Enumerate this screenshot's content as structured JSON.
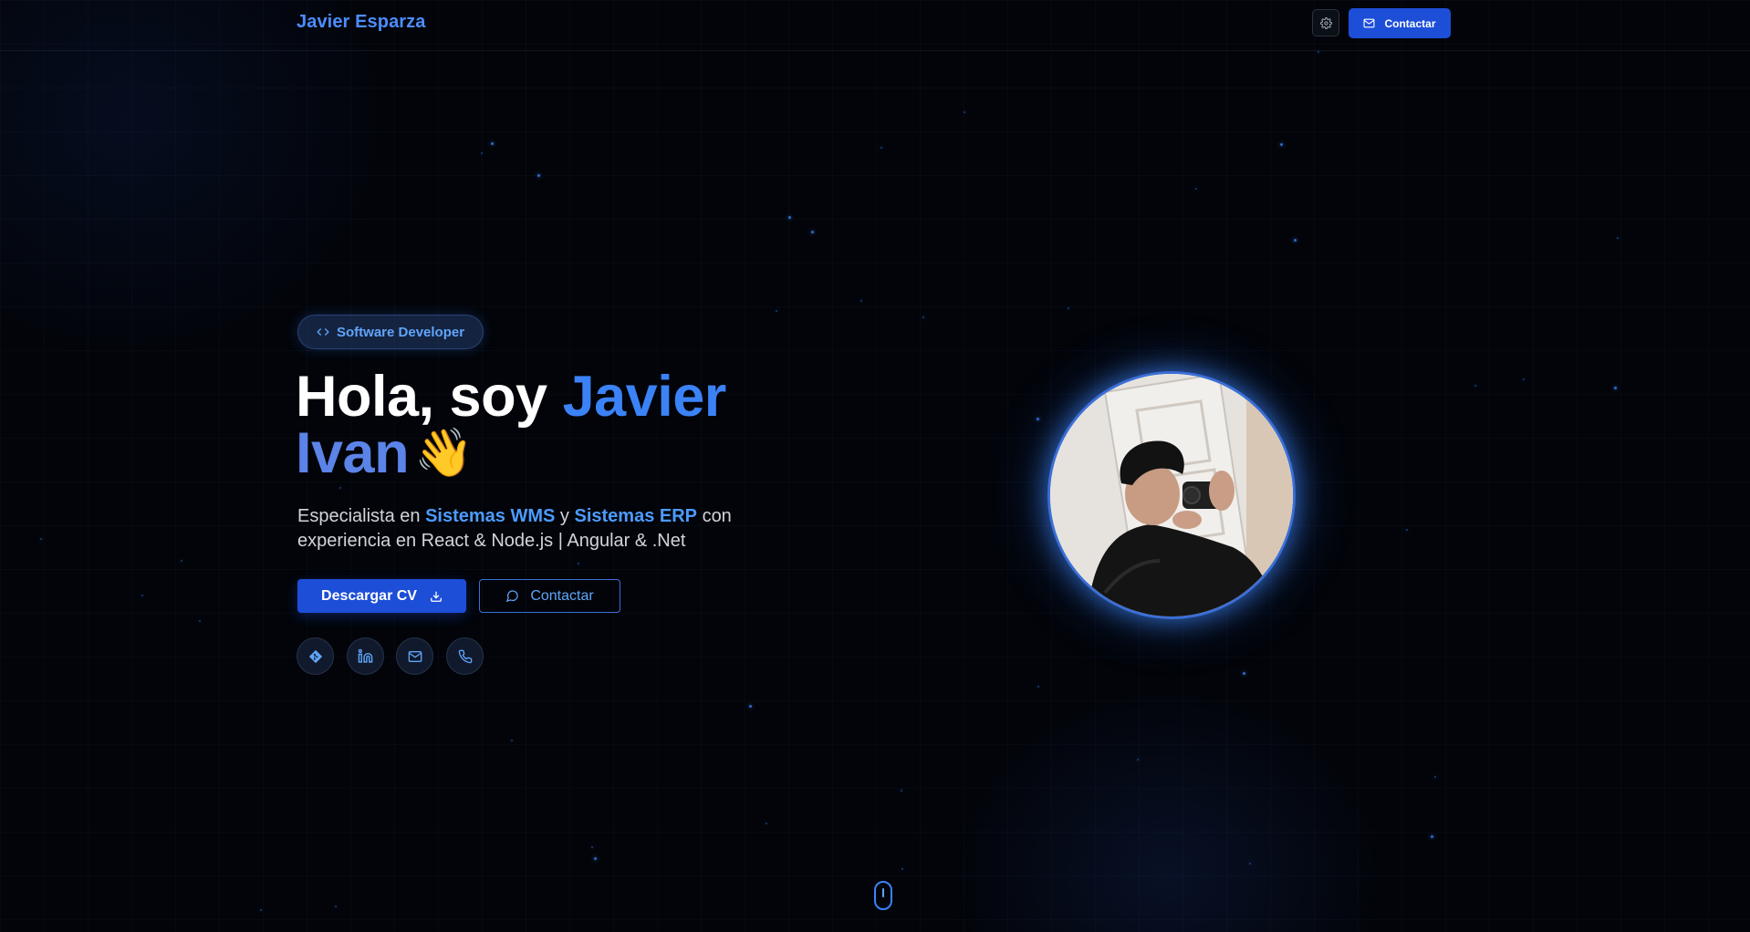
{
  "header": {
    "brand": "Javier Esparza",
    "settings_icon": "gear-icon",
    "contact_label": "Contactar",
    "contact_icon": "mail-icon"
  },
  "hero": {
    "badge": {
      "icon": "code-icon",
      "label": "Software Developer"
    },
    "title": {
      "prefix": "Hola, soy",
      "first_name": "Javier",
      "second_name": "Ivan",
      "emoji": "👋"
    },
    "subtitle": {
      "part1": "Especialista en",
      "highlight1": "Sistemas WMS",
      "part2": "y",
      "highlight2": "Sistemas ERP",
      "part3": "con experiencia en React & Node.js | Angular & .Net"
    },
    "buttons": {
      "cv_label": "Descargar CV",
      "cv_icon": "download-icon",
      "contact_label": "Contactar",
      "contact_icon": "chat-bubble-icon"
    },
    "socials": [
      {
        "name": "git-icon"
      },
      {
        "name": "linkedin-icon"
      },
      {
        "name": "mail-icon"
      },
      {
        "name": "phone-icon"
      }
    ]
  },
  "colors": {
    "accent": "#3b82f6",
    "primary_button": "#1d4ed8",
    "background": "#020409"
  }
}
